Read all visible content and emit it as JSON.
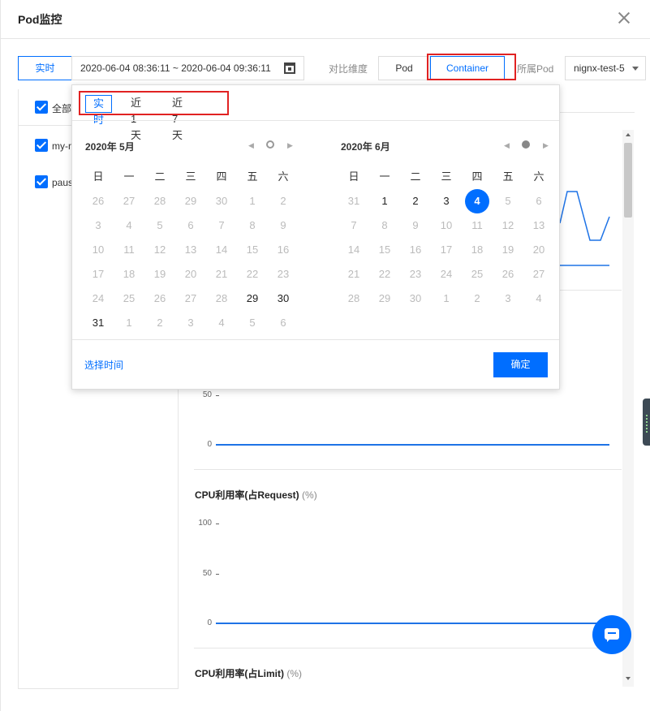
{
  "modal": {
    "title": "Pod监控"
  },
  "toolbar": {
    "realtime_label": "实时",
    "range_value": "2020-06-04 08:36:11 ~ 2020-06-04 09:36:11",
    "compare_label": "对比维度",
    "compare_options": [
      "Pod",
      "Container"
    ],
    "compare_selected": "Container",
    "belong_pod_label": "所属Pod",
    "belong_pod_value": "nignx-test-5"
  },
  "left_panel": {
    "items": [
      {
        "label": "全部",
        "checked": true
      },
      {
        "label": "my-n",
        "checked": true
      },
      {
        "label": "paus",
        "checked": true
      }
    ]
  },
  "date_picker": {
    "quick_options": [
      "实时",
      "近1天",
      "近7天"
    ],
    "quick_selected": "实时",
    "left_month": {
      "title": "2020年 5月",
      "weekdays": [
        "日",
        "一",
        "二",
        "三",
        "四",
        "五",
        "六"
      ],
      "rows": [
        [
          "26",
          "27",
          "28",
          "29",
          "30",
          "1",
          "2"
        ],
        [
          "3",
          "4",
          "5",
          "6",
          "7",
          "8",
          "9"
        ],
        [
          "10",
          "11",
          "12",
          "13",
          "14",
          "15",
          "16"
        ],
        [
          "17",
          "18",
          "19",
          "20",
          "21",
          "22",
          "23"
        ],
        [
          "24",
          "25",
          "26",
          "27",
          "28",
          "29",
          "30"
        ],
        [
          "31",
          "1",
          "2",
          "3",
          "4",
          "5",
          "6"
        ]
      ]
    },
    "right_month": {
      "title": "2020年 6月",
      "weekdays": [
        "日",
        "一",
        "二",
        "三",
        "四",
        "五",
        "六"
      ],
      "rows": [
        [
          "31",
          "1",
          "2",
          "3",
          "4",
          "5",
          "6"
        ],
        [
          "7",
          "8",
          "9",
          "10",
          "11",
          "12",
          "13"
        ],
        [
          "14",
          "15",
          "16",
          "17",
          "18",
          "19",
          "20"
        ],
        [
          "21",
          "22",
          "23",
          "24",
          "25",
          "26",
          "27"
        ],
        [
          "28",
          "29",
          "30",
          "1",
          "2",
          "3",
          "4"
        ]
      ],
      "selected_day": "4"
    },
    "choose_time_label": "选择时间",
    "confirm_label": "确定"
  },
  "charts": {
    "chart1_ticks": [
      "50",
      "0"
    ],
    "chart2": {
      "title": "CPU利用率(占Request)",
      "unit": "(%)",
      "ticks": [
        "100",
        "50",
        "0"
      ]
    },
    "chart3": {
      "title": "CPU利用率(占Limit)",
      "unit": "(%)"
    }
  },
  "colors": {
    "accent": "#006eff",
    "highlight": "#e12222",
    "series": "#1e73e6"
  }
}
